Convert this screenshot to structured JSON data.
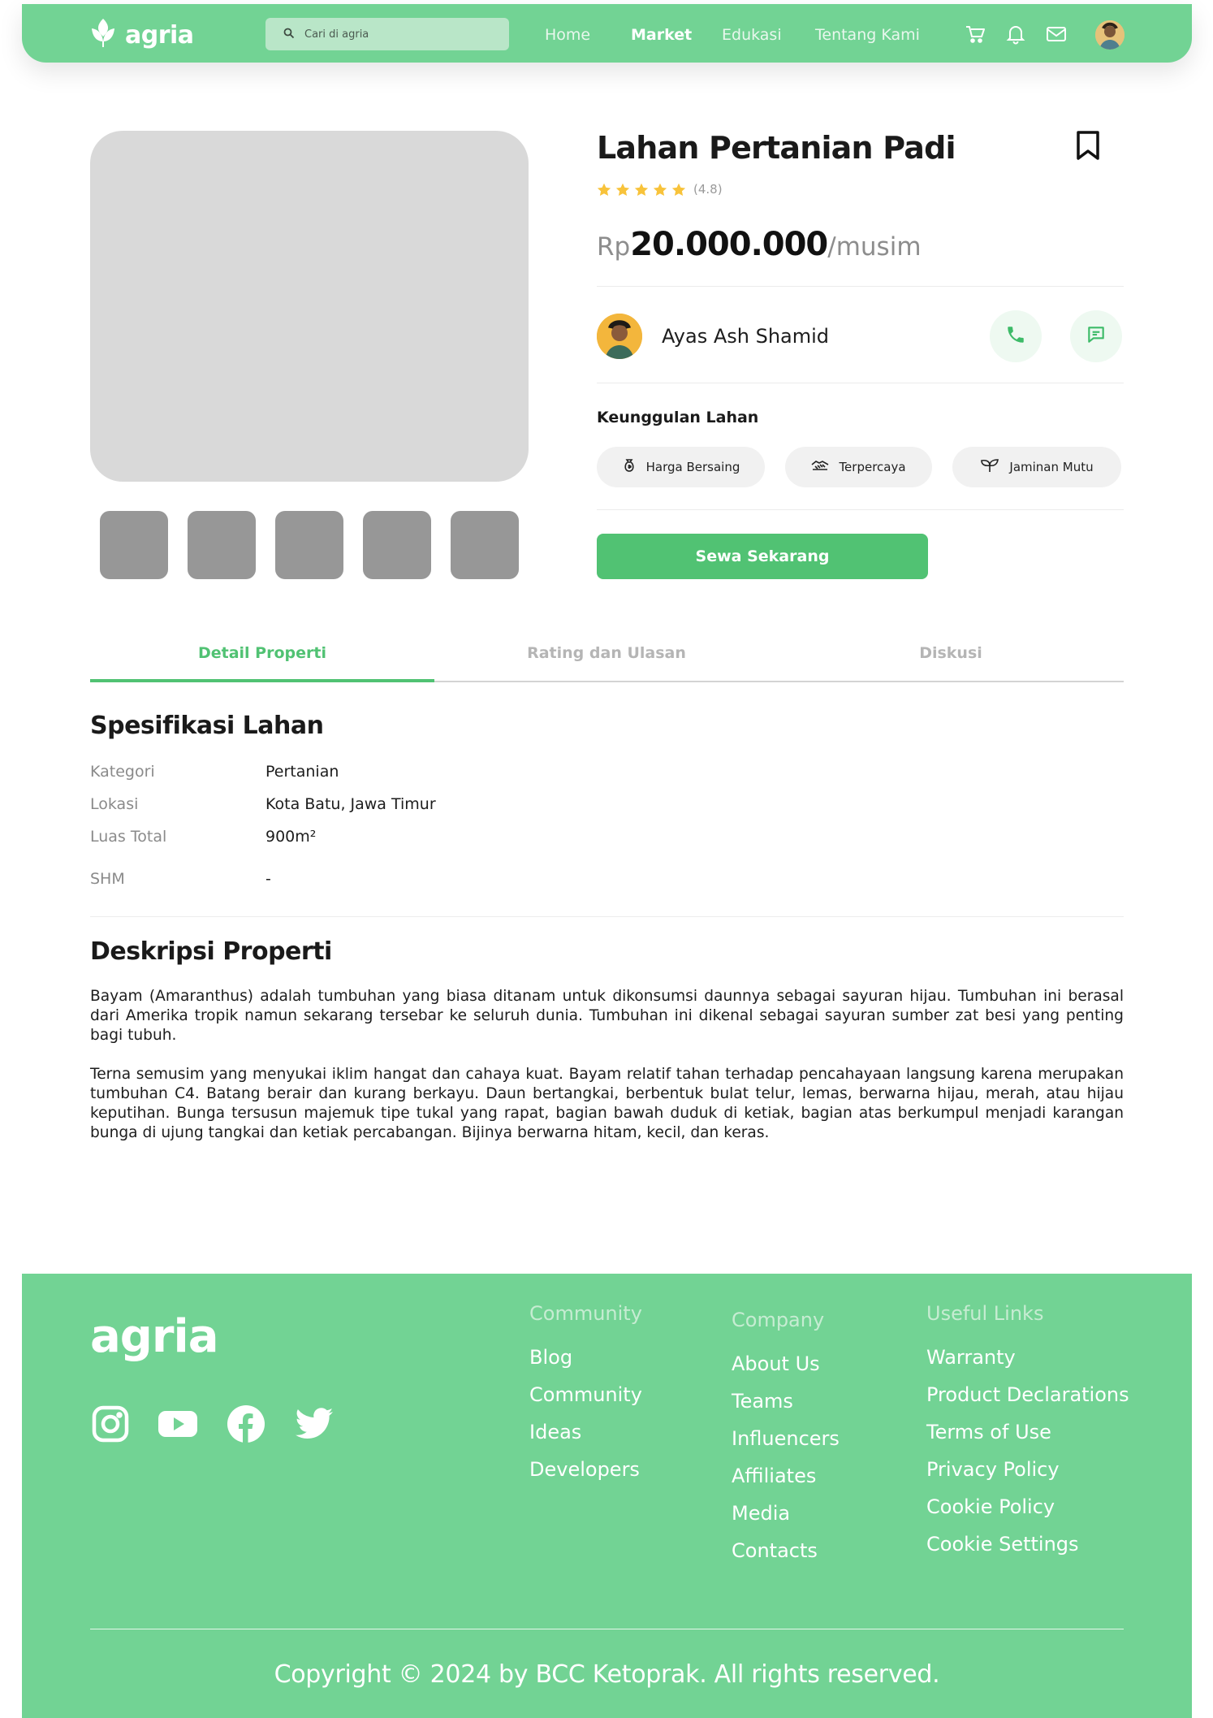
{
  "header": {
    "logo": "agria",
    "search_placeholder": "Cari di agria",
    "nav": [
      "Home",
      "Market",
      "Edukasi",
      "Tentang Kami"
    ],
    "active_nav": "Market"
  },
  "product": {
    "title": "Lahan Pertanian Padi",
    "rating_value": 4.8,
    "rating_text": "(4.8)",
    "price_currency": "Rp",
    "price_amount": "20.000.000",
    "price_unit": "/musim",
    "owner_name": "Ayas Ash Shamid",
    "advantages_title": "Keunggulan Lahan",
    "advantages": [
      "Harga Bersaing",
      "Terpercaya",
      "Jaminan Mutu"
    ],
    "cta_label": "Sewa Sekarang"
  },
  "tabs": [
    "Detail Properti",
    "Rating dan Ulasan",
    "Diskusi"
  ],
  "active_tab": "Detail Properti",
  "specs": {
    "title": "Spesifikasi Lahan",
    "rows": [
      {
        "label": "Kategori",
        "value": "Pertanian"
      },
      {
        "label": "Lokasi",
        "value": "Kota Batu, Jawa Timur"
      },
      {
        "label": "Luas Total",
        "value": "900m²"
      },
      {
        "label": "SHM",
        "value": "-"
      }
    ]
  },
  "description": {
    "title": "Deskripsi Properti",
    "paragraphs": [
      "Bayam (Amaranthus) adalah tumbuhan yang biasa ditanam untuk dikonsumsi daunnya sebagai sayuran hijau. Tumbuhan ini berasal dari Amerika tropik namun sekarang tersebar ke seluruh dunia. Tumbuhan ini dikenal sebagai sayuran sumber zat besi yang penting bagi tubuh.",
      "Terna semusim yang menyukai iklim hangat dan cahaya kuat. Bayam relatif tahan terhadap pencahayaan langsung karena merupakan tumbuhan C4. Batang berair dan kurang berkayu. Daun bertangkai, berbentuk bulat telur, lemas, berwarna hijau, merah, atau hijau keputihan. Bunga tersusun majemuk tipe tukal yang rapat, bagian bawah duduk di ketiak, bagian atas berkumpul menjadi karangan bunga di ujung tangkai dan ketiak percabangan. Bijinya berwarna hitam, kecil, dan keras."
    ]
  },
  "footer": {
    "logo": "agria",
    "columns": [
      {
        "heading": "Community",
        "links": [
          "Blog",
          "Community",
          "Ideas",
          "Developers"
        ]
      },
      {
        "heading": "Company",
        "links": [
          "About Us",
          "Teams",
          "Influencers",
          "Affiliates",
          "Media",
          "Contacts"
        ]
      },
      {
        "heading": "Useful Links",
        "links": [
          "Warranty",
          "Product Declarations",
          "Terms of Use",
          "Privacy Policy",
          "Cookie Policy",
          "Cookie Settings"
        ]
      }
    ],
    "copyright": "Copyright © 2024 by BCC Ketoprak. All rights reserved."
  },
  "colors": {
    "brand_green": "#72d394",
    "accent_green": "#51c273",
    "star": "#f8c33b"
  },
  "icons": [
    "agria-leaf-icon",
    "search-icon",
    "cart-icon",
    "bell-icon",
    "mail-icon",
    "bookmark-icon",
    "star-icon",
    "phone-icon",
    "chat-icon",
    "moneybag-icon",
    "handshake-icon",
    "sprout-icon",
    "instagram-icon",
    "youtube-icon",
    "facebook-icon",
    "twitter-icon"
  ]
}
